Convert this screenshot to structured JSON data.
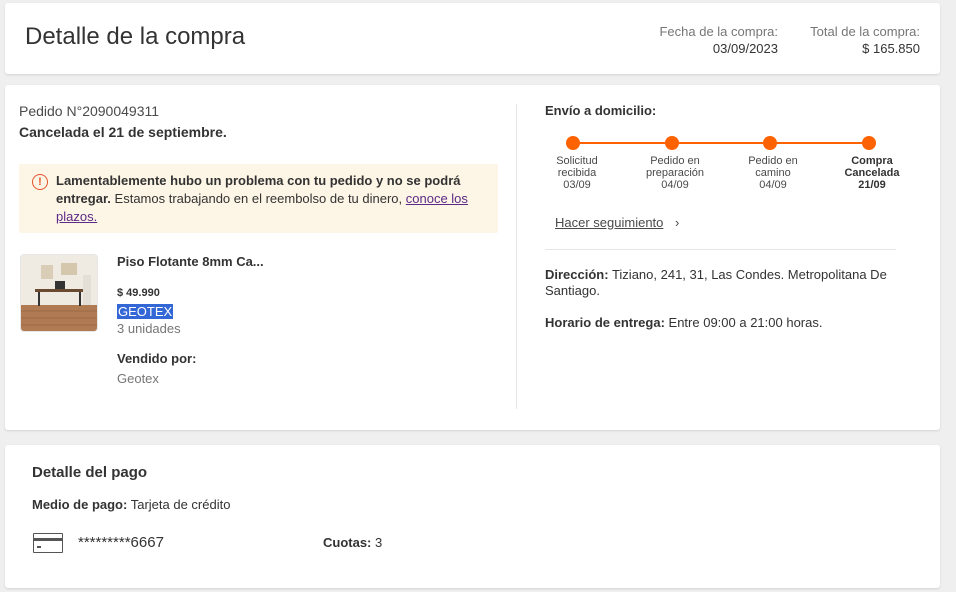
{
  "header": {
    "title": "Detalle de la compra",
    "purchase_date_label": "Fecha de la compra:",
    "purchase_date": "03/09/2023",
    "total_label": "Total de la compra:",
    "total": "$ 165.850"
  },
  "order": {
    "number": "Pedido N°2090049311",
    "status": "Cancelada el 21 de septiembre.",
    "alert": {
      "icon": "alert-circle-icon",
      "strong": "Lamentablemente hubo un problema con tu pedido y no se podrá entregar.",
      "text": " Estamos trabajando en el reembolso de tu dinero, ",
      "link": "conoce los plazos."
    },
    "product": {
      "name": "Piso Flotante 8mm Ca...",
      "price": "$ 49.990",
      "brand": "GEOTEX",
      "quantity": "3 unidades",
      "sold_by_label": "Vendido por:",
      "sold_by": "Geotex"
    },
    "shipping": {
      "title": "Envío a domicilio:",
      "timeline": [
        {
          "line1": "Solicitud",
          "line2": "recibida",
          "date": "03/09"
        },
        {
          "line1": "Pedido en",
          "line2": "preparación",
          "date": "04/09"
        },
        {
          "line1": "Pedido en",
          "line2": "camino",
          "date": "04/09"
        },
        {
          "line1": "Compra",
          "line2": "Cancelada",
          "date": "21/09"
        }
      ],
      "track_link": "Hacer seguimiento",
      "address_label": "Dirección:",
      "address": " Tiziano, 241, 31, Las Condes. Metropolitana De Santiago.",
      "delivery_label": "Horario de entrega:",
      "delivery": " Entre 09:00 a 21:00 horas."
    }
  },
  "payment": {
    "title": "Detalle del pago",
    "method_label": "Medio de pago:",
    "method": " Tarjeta de crédito",
    "card_icon": "credit-card-icon",
    "card_number": "*********6667",
    "installments_label": "Cuotas:",
    "installments": " 3"
  },
  "colors": {
    "accent": "#ff6200",
    "alert_bg": "#fdf5e6",
    "link": "#5b2a86",
    "selection": "#3367d6"
  }
}
